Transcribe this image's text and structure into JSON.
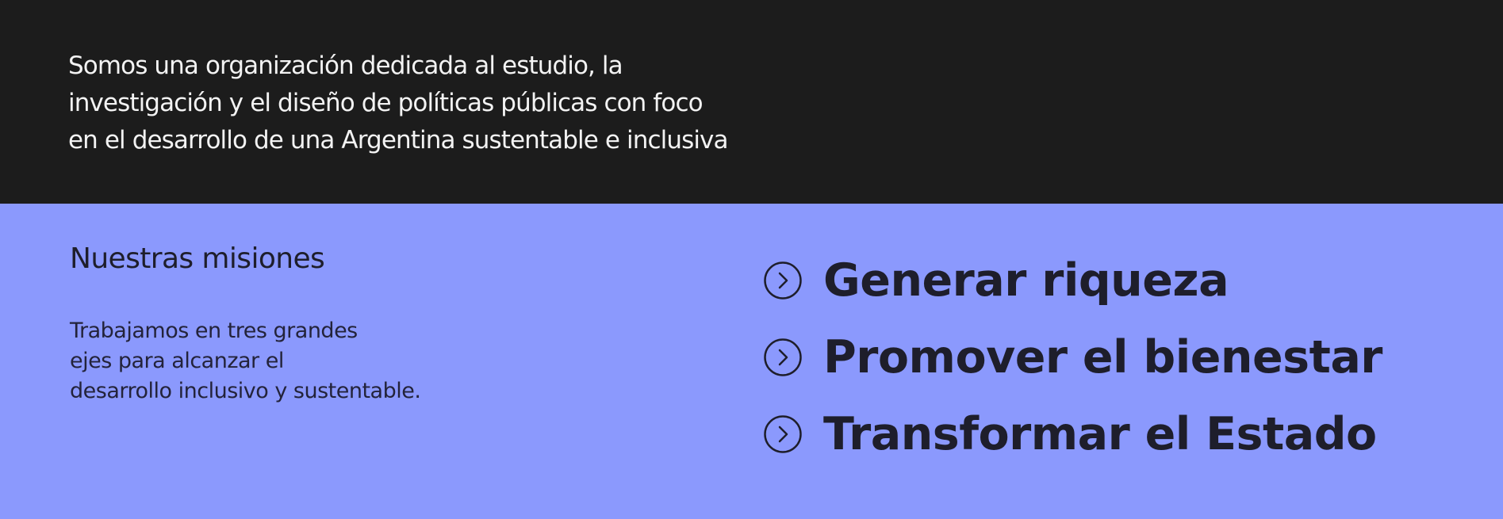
{
  "intro": {
    "lines": [
      "Somos una organización dedicada al estudio, la",
      "investigación y el diseño de políticas públicas con foco",
      "en el desarrollo de una Argentina sustentable e inclusiva"
    ]
  },
  "missions": {
    "title": "Nuestras misiones",
    "description_lines": [
      "Trabajamos en tres grandes",
      "ejes para alcanzar el",
      "desarrollo inclusivo y sustentable."
    ],
    "items": [
      {
        "label": "Generar riqueza",
        "icon": "circle-chevron-right-icon"
      },
      {
        "label": "Promover el bienestar",
        "icon": "circle-chevron-right-icon"
      },
      {
        "label": "Transformar el Estado",
        "icon": "circle-chevron-right-icon"
      }
    ]
  },
  "colors": {
    "intro_background": "#1c1c1c",
    "intro_text": "#f3f3f3",
    "missions_background": "#8b99fd",
    "missions_text": "#1e1e2b"
  }
}
